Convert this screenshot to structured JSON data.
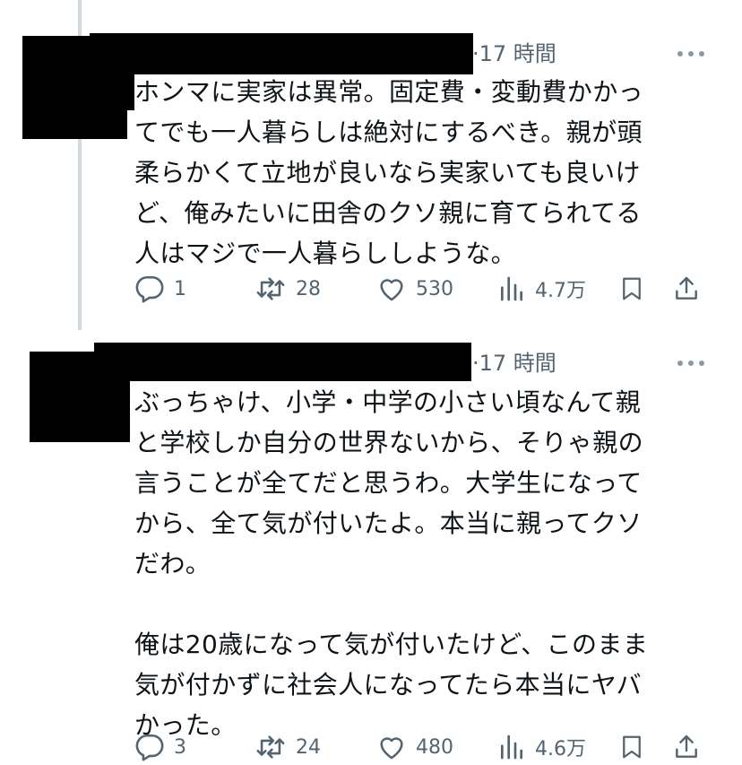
{
  "tweets": [
    {
      "time": "·17 時間",
      "text": "ホンマに実家は異常。固定費・変動費かかっ\nてでも一人暮らしは絶対にするべき。親が頭\n柔らかくて立地が良いなら実家いても良いけ\nど、俺みたいに田舎のクソ親に育てられてる\n人はマジで一人暮らししような。",
      "replies": "1",
      "retweets": "28",
      "likes": "530",
      "views": "4.7万"
    },
    {
      "time": "·17 時間",
      "text": "ぶっちゃけ、小学・中学の小さい頃なんて親\nと学校しか自分の世界ないから、そりゃ親の\n言うことが全てだと思うわ。大学生になって\nから、全て気が付いたよ。本当に親ってクソ\nだわ。\n\n俺は20歳になって気が付いたけど、このまま\n気が付かずに社会人になってたら本当にヤバ\nかった。",
      "replies": "3",
      "retweets": "24",
      "likes": "480",
      "views": "4.6万"
    }
  ],
  "icons": [
    "reply-icon",
    "retweet-icon",
    "like-icon",
    "views-icon",
    "bookmark-icon",
    "share-icon",
    "more-icon"
  ],
  "colors": {
    "text": "#0f1419",
    "secondary": "#536471",
    "thread_line": "#cfd9de",
    "redaction": "#000000"
  }
}
